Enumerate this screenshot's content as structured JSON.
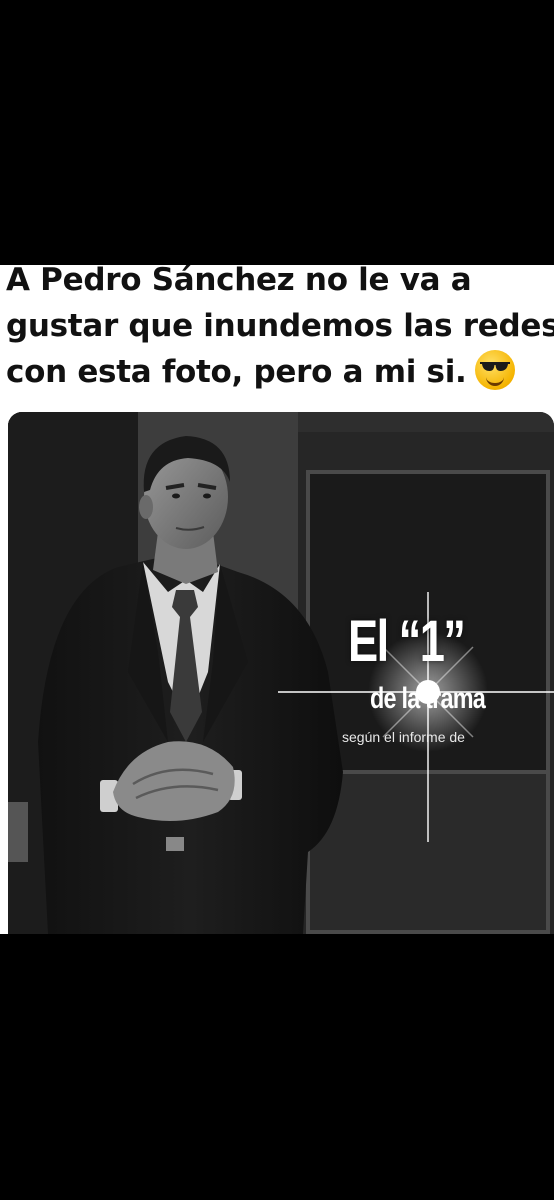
{
  "caption": {
    "line1": "A Pedro Sánchez no le va a",
    "line2": "gustar que inundemos las redes",
    "line3": "con esta foto, pero a mi si."
  },
  "caption_emoji": "smiling-face-with-sunglasses-icon",
  "photo_overlay": {
    "headline": "El “1”",
    "subheadline": "de la trama",
    "source_line": "según el informe de"
  },
  "colors": {
    "background": "#000000",
    "caption_bg": "#ffffff",
    "caption_text": "#111111",
    "overlay_text": "#ffffff"
  }
}
